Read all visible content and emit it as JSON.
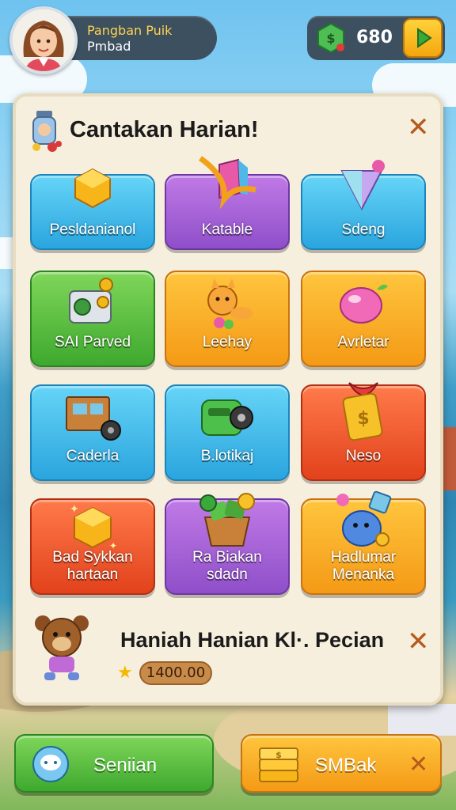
{
  "header": {
    "player_name": "Pangban Puik",
    "player_subtitle": "Pmbad",
    "currency_value": "680"
  },
  "panel": {
    "title": "Cantakan Harian!"
  },
  "tiles": [
    {
      "label": "Pesldanianol",
      "color": "blue",
      "icon": "gold-cube-icon"
    },
    {
      "label": "Katable",
      "color": "purple",
      "icon": "crystal-ribbon-icon"
    },
    {
      "label": "Sdeng",
      "color": "blue",
      "icon": "diamond-cone-icon"
    },
    {
      "label": "SAI Parved",
      "color": "green",
      "icon": "machine-icon"
    },
    {
      "label": "Leehay",
      "color": "orange",
      "icon": "fox-pet-icon"
    },
    {
      "label": "Avrletar",
      "color": "orange",
      "icon": "pink-berry-icon"
    },
    {
      "label": "Caderla",
      "color": "blue",
      "icon": "wooden-cart-icon"
    },
    {
      "label": "B.lotikaj",
      "color": "blue",
      "icon": "green-device-icon"
    },
    {
      "label": "Neso",
      "color": "red",
      "icon": "gold-tag-icon"
    },
    {
      "label_line1": "Bad Sykkan",
      "label_line2": "hartaan",
      "color": "red",
      "icon": "sparkle-gold-cube-icon"
    },
    {
      "label_line1": "Ra Biakan",
      "label_line2": "sdadn",
      "color": "purple",
      "icon": "money-basket-icon"
    },
    {
      "label_line1": "Hadlumar",
      "label_line2": "Menanka",
      "color": "orange",
      "icon": "blue-pot-icon"
    }
  ],
  "reward": {
    "title": "Haniah Hanian  Kl·. Pecian",
    "amount": "1400.00"
  },
  "bottom": {
    "left_label": "Seniian",
    "right_label": "SMBak"
  },
  "colors": {
    "panel_bg": "#f6efde",
    "hud_bg": "#3c5060",
    "close": "#b65a1c",
    "name_gold": "#ffd34d"
  }
}
